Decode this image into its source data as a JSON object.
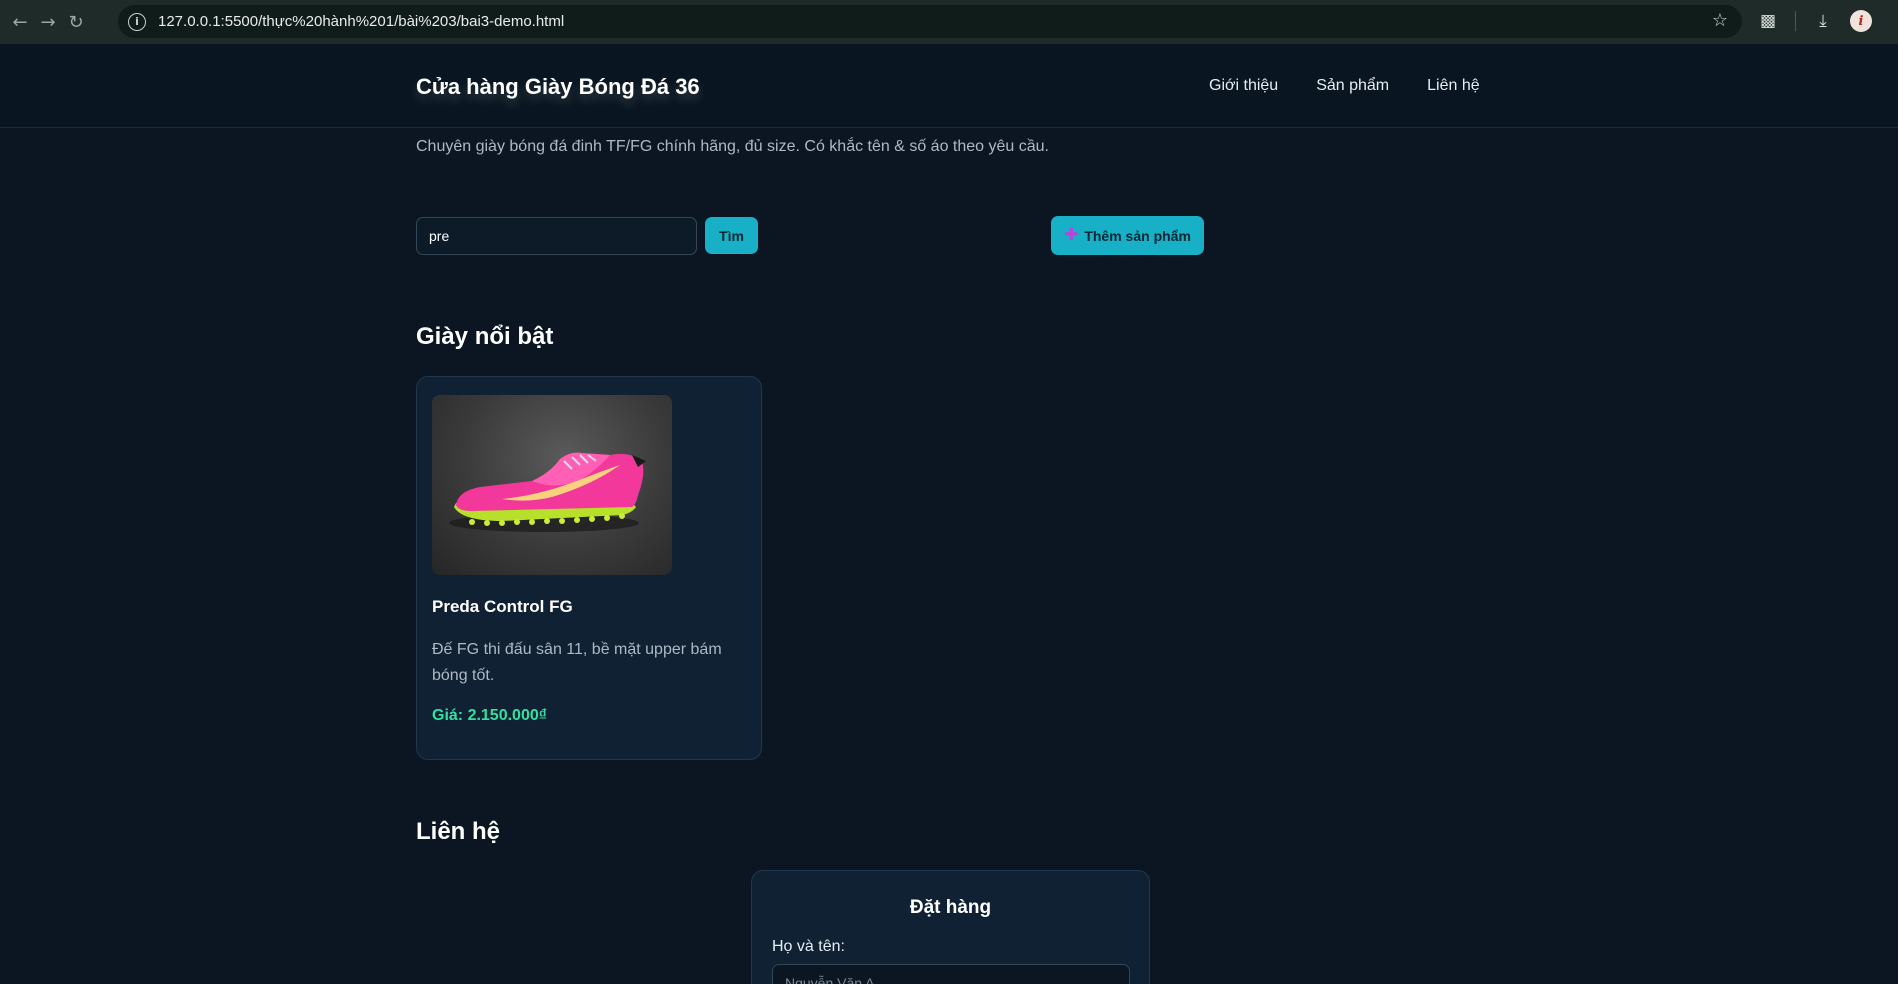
{
  "browser": {
    "url": "127.0.0.1:5500/thực%20hành%201/bài%203/bai3-demo.html",
    "icons": [
      "back-arrow-icon",
      "forward-arrow-icon",
      "reload-icon",
      "site-info-icon",
      "bookmark-star-icon",
      "extensions-icon",
      "download-icon",
      "profile-avatar-icon"
    ],
    "avatar_letter": "i"
  },
  "header": {
    "site_title": "Cửa hàng Giày Bóng Đá 36",
    "nav": [
      "Giới thiệu",
      "Sản phẩm",
      "Liên hệ"
    ]
  },
  "tagline": "Chuyên giày bóng đá đinh TF/FG chính hãng, đủ size. Có khắc tên & số áo theo yêu cầu.",
  "search": {
    "value": "pre",
    "button_label": "Tìm"
  },
  "add_product": {
    "icon": "plus-icon",
    "label": "Thêm sản phẩm"
  },
  "featured": {
    "title": "Giày nổi bật",
    "products": [
      {
        "name": "Preda Control FG",
        "description": "Đế FG thi đấu sân 11, bề mặt upper bám bóng tốt.",
        "price": "Giá: 2.150.000₫",
        "image": "pink-football-boot-image"
      }
    ]
  },
  "contact": {
    "title": "Liên hệ",
    "order_form": {
      "title": "Đặt hàng",
      "name_label": "Họ và tên:",
      "name_placeholder": "Nguyễn Văn A"
    }
  },
  "colors": {
    "page_bg": "#0b1622",
    "accent": "#17b0c7",
    "price": "#34e0a1",
    "card_bg": "#0f2133"
  }
}
